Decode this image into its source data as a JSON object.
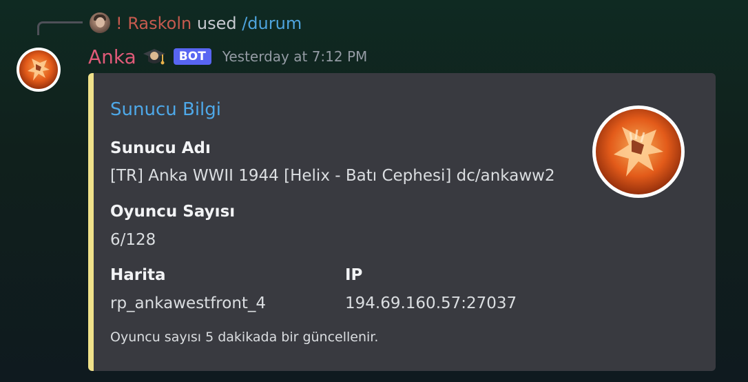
{
  "reply": {
    "user": "! Raskoln",
    "used": "used",
    "command": "/durum"
  },
  "message": {
    "author": "Anka",
    "author_emoji": "graduation-cap",
    "badge": "BOT",
    "timestamp": "Yesterday at 7:12 PM"
  },
  "embed": {
    "accent_color": "#f0e18a",
    "title": "Sunucu Bilgi",
    "fields": {
      "server_name": {
        "name": "Sunucu Adı",
        "value": "[TR] Anka WWII 1944 [Helix - Batı Cephesi] dc/ankaww2"
      },
      "player_count": {
        "name": "Oyuncu Sayısı",
        "value": "6/128"
      },
      "map": {
        "name": "Harita",
        "value": "rp_ankawestfront_4"
      },
      "ip": {
        "name": "IP",
        "value": "194.69.160.57:27037"
      }
    },
    "footer": "Oyuncu sayısı 5 dakikada bir güncellenir."
  },
  "colors": {
    "author": "#e05a78",
    "badge": "#5865f2",
    "title": "#4ea8e8",
    "reply_user": "#c55a4e",
    "command": "#4ea4de"
  }
}
